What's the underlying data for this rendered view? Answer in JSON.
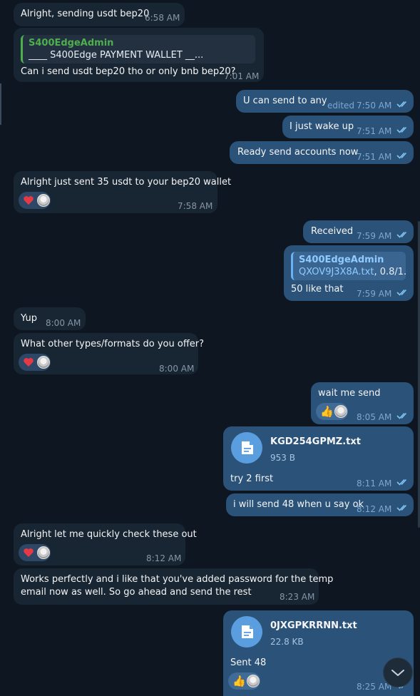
{
  "reply_name": "S400EdgeAdmin",
  "messages": {
    "m1": {
      "text": "Alright, sending usdt bep20",
      "time": "6:58 AM"
    },
    "m2": {
      "reply_name": "S400EdgeAdmin",
      "reply_text": "____ S400Edge PAYMENT WALLET __...",
      "text": "Can i send usdt bep20 tho or only bnb bep20?",
      "time": "7:01 AM"
    },
    "m3": {
      "text": "U can send to any",
      "edited": "edited",
      "time": "7:50 AM"
    },
    "m4": {
      "text": "I just wake up",
      "time": "7:51 AM"
    },
    "m5": {
      "text": "Ready send accounts now",
      "time": "7:51 AM"
    },
    "m6": {
      "text": "Alright just sent 35 usdt to your bep20 wallet",
      "time": "7:58 AM"
    },
    "m7": {
      "text": "Received",
      "time": "7:59 AM"
    },
    "m8": {
      "reply_name": "S400EdgeAdmin",
      "reply_file": "QXOV9J3X8A.txt",
      "reply_rest": ", 0.8/1....",
      "text": "50 like that",
      "time": "7:59 AM"
    },
    "m9": {
      "text": "Yup",
      "time": "8:00 AM"
    },
    "m10": {
      "text": "What other types/formats do you offer?",
      "time": "8:00 AM"
    },
    "m11": {
      "text": "wait me send",
      "time": "8:05 AM"
    },
    "m12": {
      "file_name": "KGD254GPMZ.txt",
      "file_size": "953 B",
      "text": "try 2 first",
      "time": "8:11 AM"
    },
    "m13": {
      "text": "i will send 48 when u say ok",
      "time": "8:12 AM"
    },
    "m14": {
      "text": "Alright let me quickly check these out",
      "time": "8:12 AM"
    },
    "m15": {
      "line1": "Works perfectly and i like that you've added password for the temp",
      "line2": "email now as well. So go ahead and send the rest",
      "time": "8:23 AM"
    },
    "m16": {
      "file_name": "0JXGPKRRNN.txt",
      "file_size": "22.8 KB",
      "text": "Sent 48",
      "time": "8:25 AM"
    }
  },
  "colors": {
    "background": "#0e1621",
    "incoming_bubble": "#182533",
    "outgoing_bubble": "#2b5278",
    "accent": "#6ab3f3"
  },
  "icons": {
    "read_receipt": "double-check-icon",
    "reaction_heart": "heart-icon",
    "reaction_thumb": "thumbs-up-icon",
    "file": "document-icon",
    "scroll_down": "chevron-down-icon"
  }
}
